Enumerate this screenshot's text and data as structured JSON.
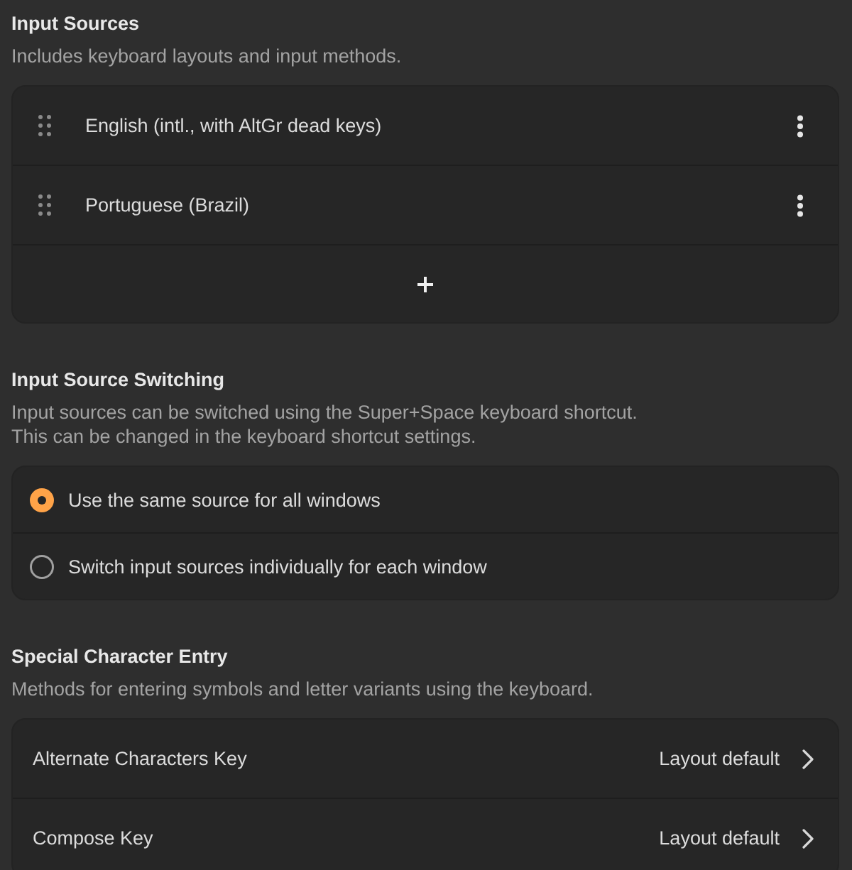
{
  "sections": [
    {
      "kind": "sources",
      "title": "Input Sources",
      "subtitle": "Includes keyboard layouts and input methods.",
      "rows": [
        {
          "label": "English (intl., with AltGr dead keys)"
        },
        {
          "label": "Portuguese (Brazil)"
        }
      ]
    },
    {
      "kind": "radio",
      "title": "Input Source Switching",
      "subtitle": "Input sources can be switched using the Super+Space keyboard shortcut.\nThis can be changed in the keyboard shortcut settings.",
      "rows": [
        {
          "label": "Use the same source for all windows",
          "selected": true
        },
        {
          "label": "Switch input sources individually for each window",
          "selected": false
        }
      ]
    },
    {
      "kind": "links",
      "title": "Special Character Entry",
      "subtitle": "Methods for entering symbols and letter variants using the keyboard.",
      "rows": [
        {
          "label": "Alternate Characters Key",
          "value": "Layout default"
        },
        {
          "label": "Compose Key",
          "value": "Layout default"
        }
      ]
    }
  ]
}
